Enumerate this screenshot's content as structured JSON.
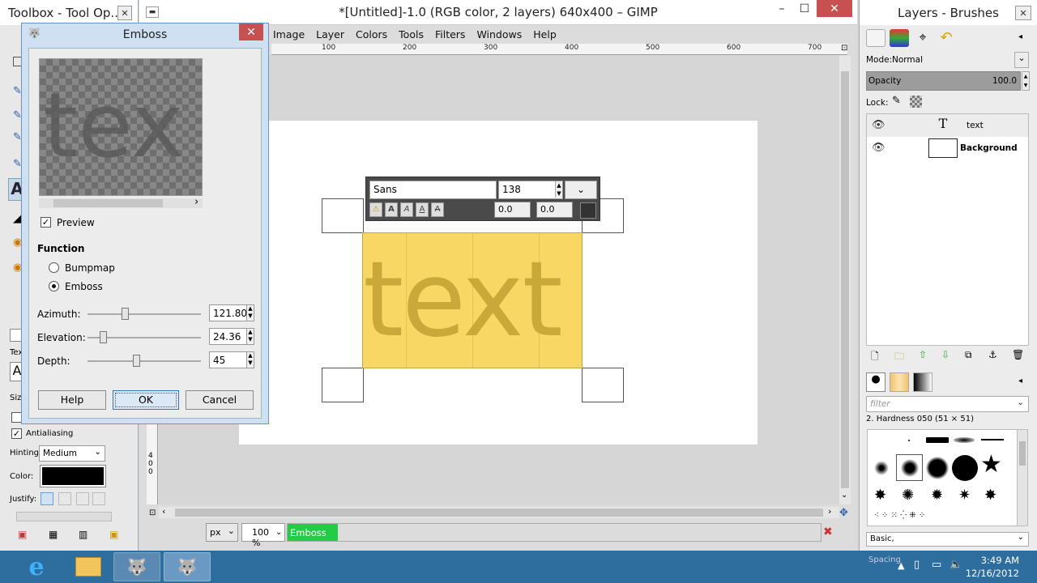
{
  "toolbox": {
    "title": "Toolbox - Tool Op...",
    "text_label": "Tex",
    "size_label": "Size",
    "antialiasing_label": "Antialiasing",
    "hinting_label": "Hinting:",
    "hinting_value": "Medium",
    "color_label": "Color:",
    "justify_label": "Justify:"
  },
  "image_window": {
    "title": "*[Untitled]-1.0 (RGB color, 2 layers) 640x400 – GIMP",
    "menus": [
      "Image",
      "Layer",
      "Colors",
      "Tools",
      "Filters",
      "Windows",
      "Help"
    ],
    "ruler_ticks": [
      "100",
      "200",
      "300",
      "400",
      "500",
      "600",
      "700"
    ],
    "vruler_ticks": [
      "4",
      "0",
      "0"
    ],
    "canvas_text": "text",
    "text_editor": {
      "font": "Sans",
      "size": "138",
      "baseline": "0.0",
      "kerning": "0.0",
      "format_buttons": [
        "A",
        "A",
        "A",
        "A"
      ]
    },
    "status": {
      "unit": "px",
      "zoom": "100 %",
      "progress_label": "Emboss"
    }
  },
  "emboss_dialog": {
    "title": "Emboss",
    "preview_text": "tex",
    "preview_label": "Preview",
    "preview_checked": true,
    "function_label": "Function",
    "options": [
      "Bumpmap",
      "Emboss"
    ],
    "selected_option": "Emboss",
    "azimuth_label": "Azimuth:",
    "azimuth_value": "121.80",
    "azimuth_fraction": 0.34,
    "elevation_label": "Elevation:",
    "elevation_value": "24.36",
    "elevation_fraction": 0.135,
    "depth_label": "Depth:",
    "depth_value": "45",
    "depth_fraction": 0.44,
    "help_label": "Help",
    "ok_label": "OK",
    "cancel_label": "Cancel"
  },
  "layers_panel": {
    "title": "Layers - Brushes",
    "mode_label": "Mode:",
    "mode_value": "Normal",
    "opacity_label": "Opacity",
    "opacity_value": "100.0",
    "lock_label": "Lock:",
    "layers": [
      {
        "name": "text",
        "bold": false
      },
      {
        "name": "Background",
        "bold": true
      }
    ],
    "brush_filter_placeholder": "filter",
    "brush_caption": "2. Hardness 050 (51 × 51)",
    "brush_preset": "Basic,",
    "spacing_label": "Spacing"
  },
  "taskbar": {
    "time": "3:49 AM",
    "date": "12/16/2012"
  },
  "colors": {
    "accent": "#2e6e9e",
    "text_layer": "#f8d764",
    "progress": "#22cc44"
  }
}
